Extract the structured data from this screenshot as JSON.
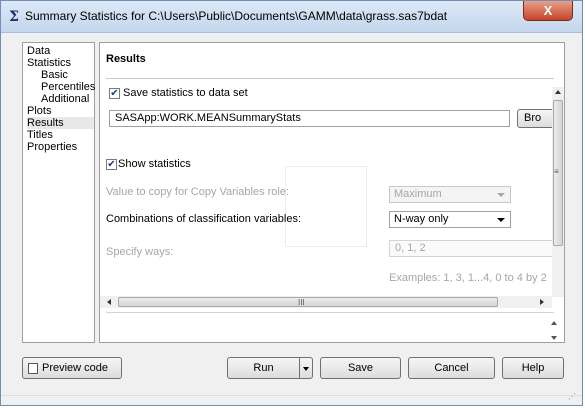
{
  "window": {
    "title": "Summary Statistics for C:\\Users\\Public\\Documents\\GAMM\\data\\grass.sas7bdat",
    "close_label": "X"
  },
  "nav": {
    "items": [
      {
        "label": "Data",
        "level": 0,
        "selected": false
      },
      {
        "label": "Statistics",
        "level": 0,
        "selected": false
      },
      {
        "label": "Basic",
        "level": 1,
        "selected": false
      },
      {
        "label": "Percentiles",
        "level": 1,
        "selected": false
      },
      {
        "label": "Additional",
        "level": 1,
        "selected": false
      },
      {
        "label": "Plots",
        "level": 0,
        "selected": false
      },
      {
        "label": "Results",
        "level": 0,
        "selected": true
      },
      {
        "label": "Titles",
        "level": 0,
        "selected": false
      },
      {
        "label": "Properties",
        "level": 0,
        "selected": false
      }
    ]
  },
  "results": {
    "heading": "Results",
    "save_stats": {
      "label": "Save statistics to data set",
      "checked": true
    },
    "dataset_value": "SASApp:WORK.MEANSummaryStats",
    "browse_label": "Bro",
    "show_stats": {
      "label": "Show statistics",
      "checked": true
    },
    "copy_role_label": "Value to copy for Copy Variables role:",
    "copy_role_value": "Maximum",
    "combinations_label": "Combinations of classification variables:",
    "combinations_value": "N-way only",
    "ways_label": "Specify ways:",
    "ways_value": "0, 1, 2",
    "examples": "Examples: 1, 3, 1...4, 0 to 4 by 2"
  },
  "buttons": {
    "preview": "Preview code",
    "run": "Run",
    "save": "Save",
    "cancel": "Cancel",
    "help": "Help"
  },
  "hscroll_grip": "III",
  "vscroll_grip": "≡"
}
